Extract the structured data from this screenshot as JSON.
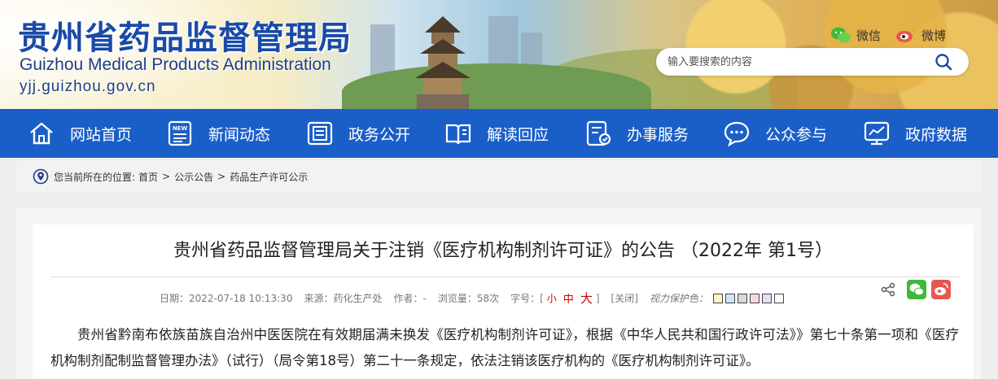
{
  "header": {
    "title_cn": "贵州省药品监督管理局",
    "title_en": "Guizhou Medical Products Administration",
    "url": "yjj.guizhou.gov.cn",
    "wechat_label": "微信",
    "weibo_label": "微博",
    "search_placeholder": "输入要搜索的内容"
  },
  "nav": {
    "items": [
      {
        "label": "网站首页",
        "icon": "home-icon"
      },
      {
        "label": "新闻动态",
        "icon": "news-icon"
      },
      {
        "label": "政务公开",
        "icon": "document-list-icon"
      },
      {
        "label": "解读回应",
        "icon": "open-book-icon"
      },
      {
        "label": "办事服务",
        "icon": "service-form-icon"
      },
      {
        "label": "公众参与",
        "icon": "chat-bubble-icon"
      },
      {
        "label": "政府数据",
        "icon": "data-chart-icon"
      }
    ]
  },
  "breadcrumb": {
    "prefix": "您当前所在的位置:",
    "items": [
      "首页",
      "公示公告",
      "药品生产许可公示"
    ],
    "separator": ">"
  },
  "article": {
    "title": "贵州省药品监督管理局关于注销《医疗机构制剂许可证》的公告 （2022年 第1号）",
    "meta": {
      "date": "日期：2022-07-18 10:13:30",
      "source": "来源：药化生产处",
      "author": "作者：-",
      "views": "浏览量：58次",
      "font_size_label": "字号：[",
      "font_small": "小",
      "font_medium": "中",
      "font_large": "大",
      "font_close": "]",
      "close": "[关闭]",
      "eye_protect": "视力保护色："
    },
    "eye_colors": [
      "#fdf7c4",
      "#cfe8f8",
      "#d9d9d9",
      "#f6d7e3",
      "#e8dcf4",
      "#ffffff"
    ],
    "body": "贵州省黔南布依族苗族自治州中医医院在有效期届满未换发《医疗机构制剂许可证》，根据《中华人民共和国行政许可法》》第七十条第一项和《医疗机构制剂配制监督管理办法》（试行）（局令第18号）第二十一条规定，依法注销该医疗机构的《医疗机构制剂许可证》。"
  },
  "colors": {
    "nav_bg": "#1a5fc8",
    "title_blue": "#1a4aa8",
    "wechat_green": "#3fb93a",
    "weibo_red": "#e8574f"
  }
}
